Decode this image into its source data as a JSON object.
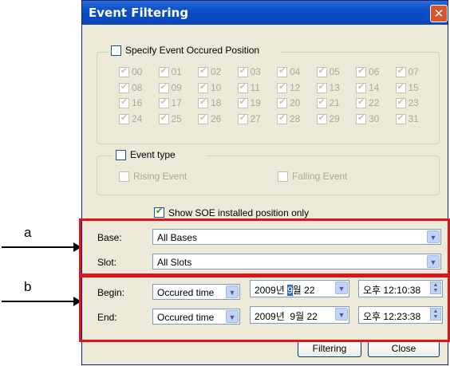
{
  "window": {
    "title": "Event Filtering"
  },
  "position_group": {
    "checkbox_label": "Specify Event Occured Position",
    "positions": [
      "00",
      "01",
      "02",
      "03",
      "04",
      "05",
      "06",
      "07",
      "08",
      "09",
      "10",
      "11",
      "12",
      "13",
      "14",
      "15",
      "16",
      "17",
      "18",
      "19",
      "20",
      "21",
      "22",
      "23",
      "24",
      "25",
      "26",
      "27",
      "28",
      "29",
      "30",
      "31"
    ]
  },
  "event_type_group": {
    "checkbox_label": "Event type",
    "rising_label": "Rising Event",
    "falling_label": "Falling Event"
  },
  "show_soe": {
    "label": "Show SOE installed position only",
    "checked": true
  },
  "base": {
    "label": "Base:",
    "value": "All Bases"
  },
  "slot": {
    "label": "Slot:",
    "value": "All Slots"
  },
  "begin": {
    "label": "Begin:",
    "mode": "Occured time",
    "date_year": "2009년 ",
    "date_month": "9",
    "date_rest": "월 22",
    "time": "오후 12:10:38"
  },
  "end": {
    "label": "End:",
    "mode": "Occured time",
    "date": "2009년  9월 22",
    "time": "오후 12:23:38"
  },
  "buttons": {
    "filtering": "Filtering",
    "close": "Close"
  },
  "annotations": {
    "a": "a",
    "b": "b"
  },
  "colors": {
    "title_bar": "#0a4fc6",
    "highlight_box": "#e0121b",
    "dialog_bg": "#ece9d8"
  }
}
